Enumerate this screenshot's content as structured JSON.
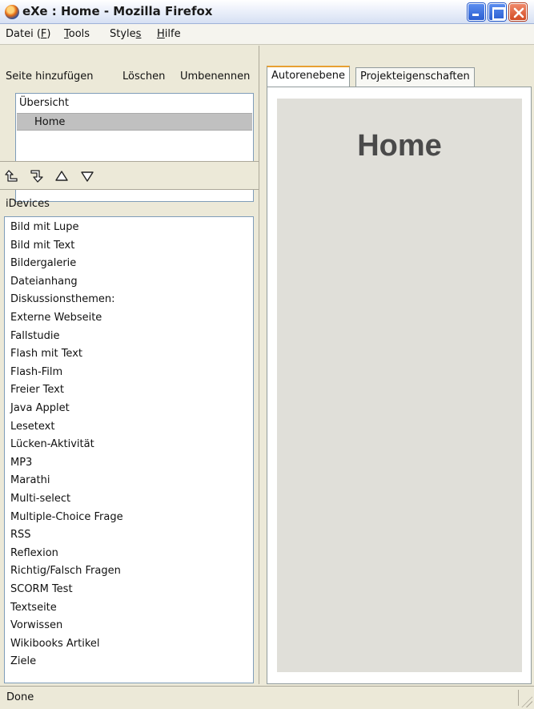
{
  "window": {
    "title": "eXe : Home - Mozilla Firefox",
    "accent": "#2b5fd1",
    "close_color": "#d24a22"
  },
  "menubar": {
    "items": [
      {
        "label_prefix": "Datei (",
        "label_underline": "F",
        "label_suffix": ")"
      },
      {
        "label_prefix": "",
        "label_underline": "T",
        "label_suffix": "ools"
      },
      {
        "label_prefix": "Style",
        "label_underline": "s",
        "label_suffix": ""
      },
      {
        "label_prefix": "",
        "label_underline": "H",
        "label_suffix": "ilfe"
      }
    ]
  },
  "outline": {
    "actions": {
      "add": "Seite hinzufügen",
      "delete": "Löschen",
      "rename": "Umbenennen"
    },
    "tree": {
      "root": "Übersicht",
      "child": "Home"
    },
    "arrows": [
      "promote-icon",
      "demote-icon",
      "move-up-icon",
      "move-down-icon"
    ]
  },
  "idevices": {
    "label": "iDevices",
    "items": [
      "Bild mit Lupe",
      "Bild mit Text",
      "Bildergalerie",
      "Dateianhang",
      "Diskussionsthemen:",
      "Externe Webseite",
      "Fallstudie",
      "Flash mit Text",
      "Flash-Film",
      "Freier Text",
      "Java Applet",
      "Lesetext",
      "Lücken-Aktivität",
      "MP3",
      "Marathi",
      "Multi-select",
      "Multiple-Choice Frage",
      "RSS",
      "Reflexion",
      "Richtig/Falsch Fragen",
      "SCORM Test",
      "Textseite",
      "Vorwissen",
      "Wikibooks Artikel",
      "Ziele"
    ]
  },
  "tabs": {
    "authoring": "Autorenebene",
    "properties": "Projekteigenschaften"
  },
  "page": {
    "heading": "Home"
  },
  "status": {
    "text": "Done"
  }
}
